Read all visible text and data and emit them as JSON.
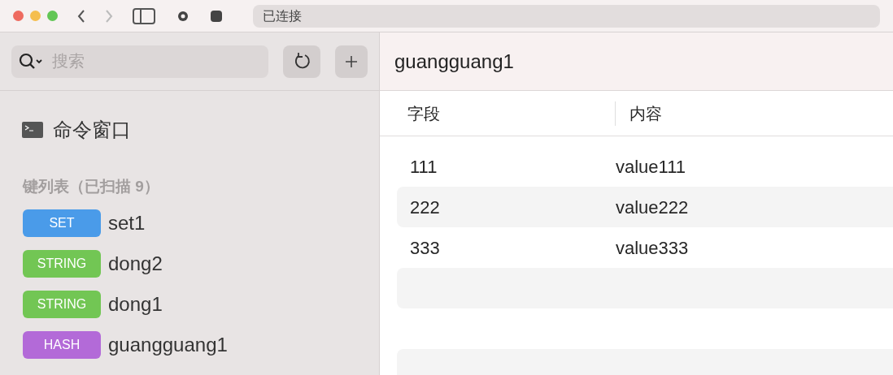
{
  "toolbar": {
    "status": "已连接"
  },
  "sidebar": {
    "search": {
      "placeholder": "搜索"
    },
    "command_window": {
      "label": "命令窗口"
    },
    "key_list_title": "键列表（已扫描 9）",
    "keys": [
      {
        "type": "SET",
        "color": "#4a9be9",
        "name": "set1",
        "selected": false
      },
      {
        "type": "STRING",
        "color": "#72c654",
        "name": "dong2",
        "selected": false
      },
      {
        "type": "STRING",
        "color": "#72c654",
        "name": "dong1",
        "selected": false
      },
      {
        "type": "HASH",
        "color": "#b36ad8",
        "name": "guangguang1",
        "selected": false
      }
    ]
  },
  "detail": {
    "key_name": "guangguang1",
    "table": {
      "columns": [
        "字段",
        "内容"
      ],
      "rows": [
        [
          "111",
          "value111"
        ],
        [
          "222",
          "value222"
        ],
        [
          "333",
          "value333"
        ]
      ]
    }
  }
}
